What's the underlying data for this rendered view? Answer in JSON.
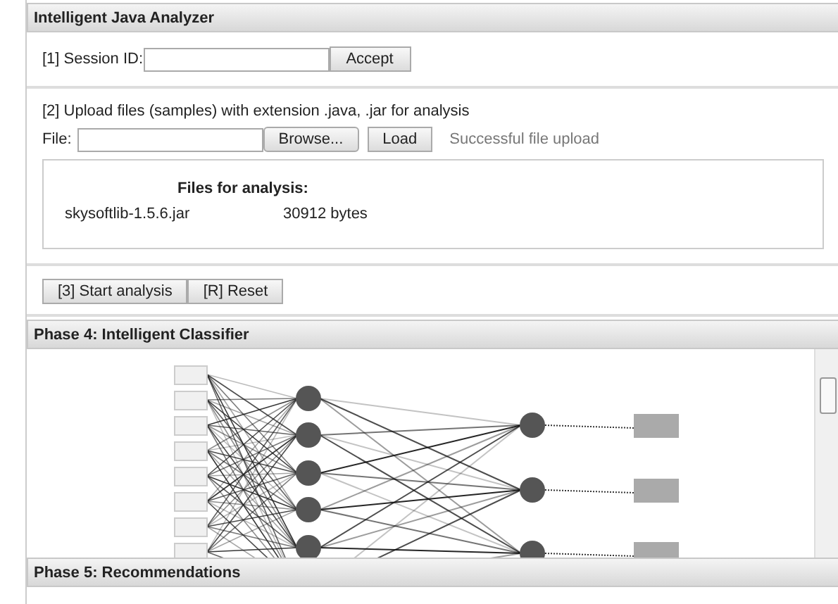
{
  "app": {
    "title": "Intelligent Java Analyzer"
  },
  "session": {
    "label": "[1] Session ID:",
    "button": "Accept"
  },
  "upload": {
    "instruction": "[2] Upload files (samples) with extension .java, .jar for analysis",
    "file_label": "File:",
    "browse_button": "Browse...",
    "load_button": "Load",
    "status": "Successful file upload",
    "files_heading": "Files for analysis:",
    "files": [
      {
        "name": "skysoftlib-1.5.6.jar",
        "size": "30912 bytes"
      }
    ]
  },
  "actions": [
    "[3] Start analysis",
    "[R] Reset"
  ],
  "phase4": {
    "title": "Phase 4: Intelligent Classifier"
  },
  "phase5": {
    "title": "Phase 5: Recommendations"
  }
}
